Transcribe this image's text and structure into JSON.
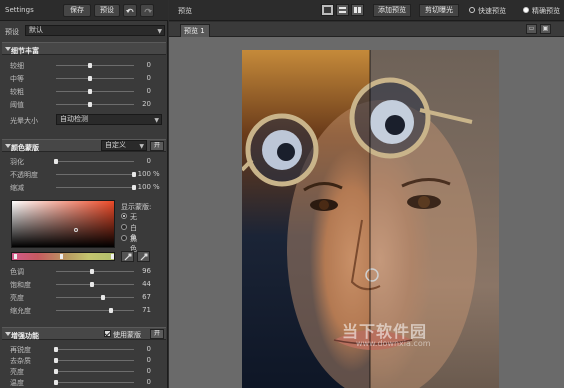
{
  "left_panel": {
    "title": "Settings",
    "save_label": "保存",
    "preset_label": "预设",
    "undo_icon": "undo-icon",
    "redo_icon": "redo-icon",
    "preset_row": {
      "label": "预设",
      "value": "默认"
    },
    "detail_section": {
      "title": "细节丰富",
      "sliders": [
        {
          "label": "较细",
          "value": "0",
          "pos": 0.43
        },
        {
          "label": "中等",
          "value": "0",
          "pos": 0.43
        },
        {
          "label": "较粗",
          "value": "0",
          "pos": 0.43
        },
        {
          "label": "阈值",
          "value": "20",
          "pos": 0.43
        }
      ],
      "halo_label": "光晕大小",
      "halo_value": "自动检测"
    },
    "color_section": {
      "title": "颜色蒙版",
      "mode_value": "自定义",
      "toggle_label": "开",
      "sliders": [
        {
          "label": "羽化",
          "value": "0",
          "unit": "",
          "pos": 0.0
        },
        {
          "label": "不透明度",
          "value": "100",
          "unit": "%",
          "pos": 1.0
        },
        {
          "label": "缩减",
          "value": "100",
          "unit": "%",
          "pos": 1.0
        }
      ],
      "display_mask_label": "显示蒙版:",
      "radios": [
        {
          "label": "无",
          "selected": true
        },
        {
          "label": "白色",
          "selected": false
        },
        {
          "label": "黑色",
          "selected": false
        }
      ],
      "hsl_sliders": [
        {
          "label": "色调",
          "value": "96",
          "pos": 0.46
        },
        {
          "label": "饱和度",
          "value": "44",
          "pos": 0.46
        },
        {
          "label": "亮度",
          "value": "67",
          "pos": 0.6
        },
        {
          "label": "缩允度",
          "value": "71",
          "pos": 0.7
        }
      ]
    },
    "edge_section": {
      "title": "增强功能",
      "use_mask_label": "使用蒙版",
      "toggle_label": "开",
      "sliders": [
        {
          "label": "再锐度",
          "value": "0",
          "pos": 0.0
        },
        {
          "label": "去杂质",
          "value": "0",
          "pos": 0.0
        },
        {
          "label": "亮度",
          "value": "0",
          "pos": 0.0
        },
        {
          "label": "温度",
          "value": "0",
          "pos": 0.0
        }
      ]
    }
  },
  "toolbar": {
    "preview_label": "预览",
    "add_preview_label": "添加预览",
    "clip_label": "剪切曝光",
    "fast_preview_label": "快速预览",
    "precise_preview_label": "精确预览"
  },
  "preview": {
    "tab_label": "预览 1"
  },
  "watermark": {
    "line1": "当下软件园",
    "line2": "www.downxia.com"
  }
}
